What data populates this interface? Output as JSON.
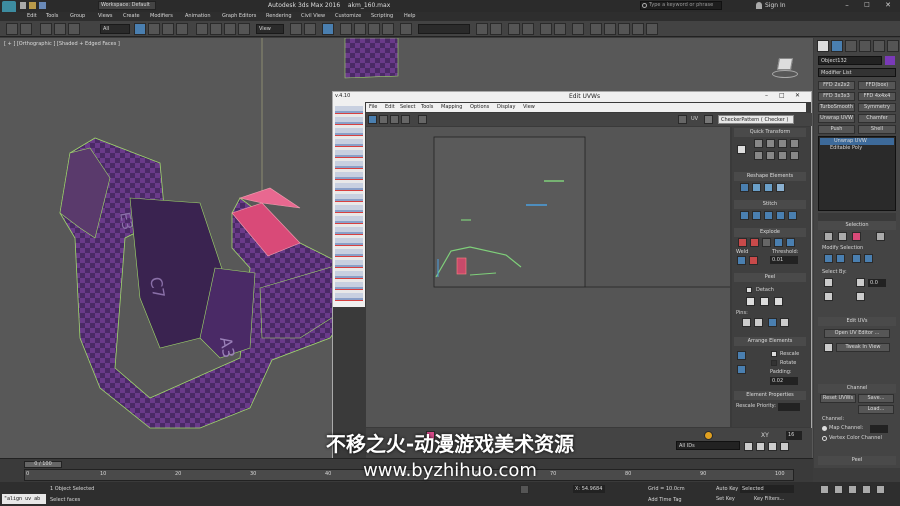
{
  "app": {
    "title": "Autodesk 3ds Max 2016",
    "file": "akm_160.max",
    "workspace": "Workspace: Default",
    "search_placeholder": "Type a keyword or phrase",
    "sign_in": "Sign In"
  },
  "menu": [
    "Edit",
    "Tools",
    "Group",
    "Views",
    "Create",
    "Modifiers",
    "Animation",
    "Graph Editors",
    "Rendering",
    "Civil View",
    "Customize",
    "Scripting",
    "Help"
  ],
  "toolbar": {
    "filter": "All",
    "view": "View"
  },
  "viewport": {
    "label": "[ + ] [Orthographic ] [Shaded + Edged Faces ]"
  },
  "uv_editor": {
    "version": "v.4.10",
    "title": "Edit UVWs",
    "menu": [
      "File",
      "Edit",
      "Select",
      "Tools",
      "Mapping",
      "Options",
      "Display",
      "View"
    ],
    "uv_label": "UV",
    "pattern": "CheckerPattern ( Checker )",
    "sections": {
      "quick_transform": "Quick Transform",
      "reshape": "Reshape Elements",
      "stitch": "Stitch",
      "explode": "Explode",
      "weld": "Weld",
      "threshold": "Threshold:",
      "threshold_val": "0.01",
      "peel": "Peel",
      "detach": "Detach",
      "pins": "Pins:",
      "arrange": "Arrange Elements",
      "rescale": "Rescale",
      "rotate": "Rotate",
      "padding": "Padding:",
      "padding_val": "0.02",
      "element_props": "Element Properties",
      "rescale_priority": "Rescale Priority:"
    },
    "bottom": {
      "all_ids": "All IDs",
      "xy": "XY",
      "value": "16"
    }
  },
  "command_panel": {
    "object_name": "Object132",
    "modifier_list": "Modifier List",
    "mod_buttons": [
      "FFD 2x2x2",
      "FFD(box)",
      "FFD 3x3x3",
      "FFD 4x4x4",
      "TurboSmooth",
      "Symmetry",
      "Unwrap UVW",
      "Chamfer",
      "Push",
      "Shell"
    ],
    "stack": [
      "Unwrap UVW",
      "Editable Poly"
    ],
    "selection": "Selection",
    "modify_selection": "Modify Selection",
    "select_by": "Select By:",
    "edit_uvs": "Edit UVs",
    "open_uv_editor": "Open UV Editor ...",
    "tweak_in_view": "Tweak In View",
    "channel": "Channel",
    "reset_uvws": "Reset UVWs",
    "save": "Save...",
    "load": "Load...",
    "channel_label": "Channel:",
    "map_channel": "Map Channel:",
    "vertex_color": "Vertex Color Channel",
    "peel": "Peel",
    "spin_val": "0.0"
  },
  "timeline": {
    "frame": "0 / 100",
    "ticks": [
      "0",
      "10",
      "20",
      "30",
      "40",
      "50",
      "60",
      "70",
      "80",
      "90",
      "100"
    ]
  },
  "status": {
    "maxscript": "\"align uv ab",
    "selected": "1 Object Selected",
    "prompt": "Select faces",
    "x": "X: 54.9684",
    "grid": "Grid = 10.0cm",
    "auto_key": "Auto Key",
    "selected_dd": "Selected",
    "set_key": "Set Key",
    "key_filters": "Key Filters...",
    "add_time_tag": "Add Time Tag"
  },
  "watermark": {
    "line1": "不移之火-动漫游戏美术资源",
    "line2": "www.byzhihuo.com"
  }
}
